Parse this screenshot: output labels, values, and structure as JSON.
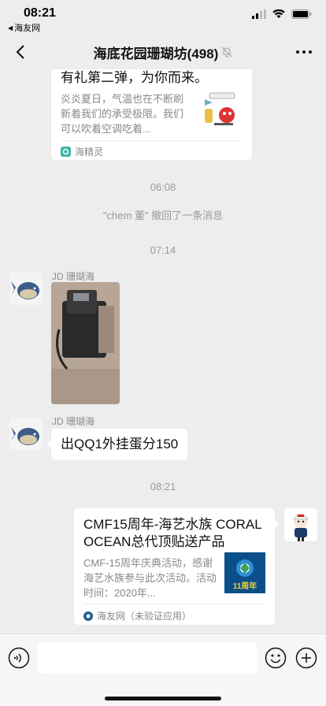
{
  "status_bar": {
    "time": "08:21",
    "back_app": "海友网"
  },
  "nav": {
    "title": "海底花园珊瑚坊(498)",
    "muted_icon": "bell-slash-icon"
  },
  "messages": {
    "card_top": {
      "title": "有礼第二弹，为你而来。",
      "description": "炎炎夏日，气温也在不断刷新着我们的承受极限。我们可以吹着空调吃着...",
      "source": "海精灵"
    },
    "time_1": "06:08",
    "recall_notice": "\"chem 董\" 撤回了一条消息",
    "time_2": "07:14",
    "msg_image": {
      "sender": "JD 珊瑚海"
    },
    "msg_text": {
      "sender": "JD 珊瑚海",
      "text": "出QQ1外挂蛋分150"
    },
    "time_3": "08:21",
    "card_right": {
      "title": "CMF15周年-海艺水族 CORAL OCEAN总代顶贴送产品",
      "description": "CMF-15周年庆典活动，感谢海艺水族参与此次活动。活动时间：2020年...",
      "source": "海友网（未验证应用）",
      "thumb_text": "11周年"
    }
  },
  "input_bar": {
    "placeholder": ""
  },
  "colors": {
    "background": "#ededed",
    "bubble": "#ffffff",
    "system_text": "#9a9a9a"
  }
}
